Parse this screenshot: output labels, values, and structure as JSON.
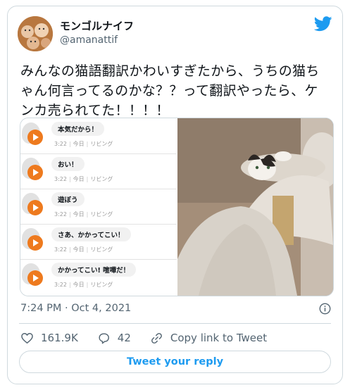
{
  "author": {
    "name": "モンゴルナイフ",
    "handle": "@amanattif"
  },
  "tweet": {
    "text": "みんなの猫語翻訳かわいすぎたから、うちの猫ちゃん何言ってるのかな？？って翻訳やったら、ケンカ売られてた！！！！"
  },
  "chat": {
    "messages": [
      {
        "text": "本気だから！",
        "time": "3:22",
        "day": "今日",
        "place": "リビング"
      },
      {
        "text": "おい！",
        "time": "3:22",
        "day": "今日",
        "place": "リビング"
      },
      {
        "text": "遊ぼう",
        "time": "3:22",
        "day": "今日",
        "place": "リビング"
      },
      {
        "text": "さあ、かかってこい！",
        "time": "3:22",
        "day": "今日",
        "place": "リビング"
      },
      {
        "text": "かかってこい! 喧嘩だ！",
        "time": "3:22",
        "day": "今日",
        "place": "リビング"
      }
    ]
  },
  "footer": {
    "datetime": "7:24 PM · Oct 4, 2021",
    "likes": "161.9K",
    "replies": "42",
    "copy_link": "Copy link to Tweet",
    "reply_button": "Tweet your reply"
  },
  "icons": {
    "brand": "twitter-bird-icon",
    "info": "info-icon",
    "like": "heart-icon",
    "reply": "reply-bubble-icon",
    "link": "link-icon"
  },
  "colors": {
    "accent": "#1d9bf0",
    "play": "#ee7a1e",
    "muted": "#536471",
    "border": "#cfd9de"
  }
}
